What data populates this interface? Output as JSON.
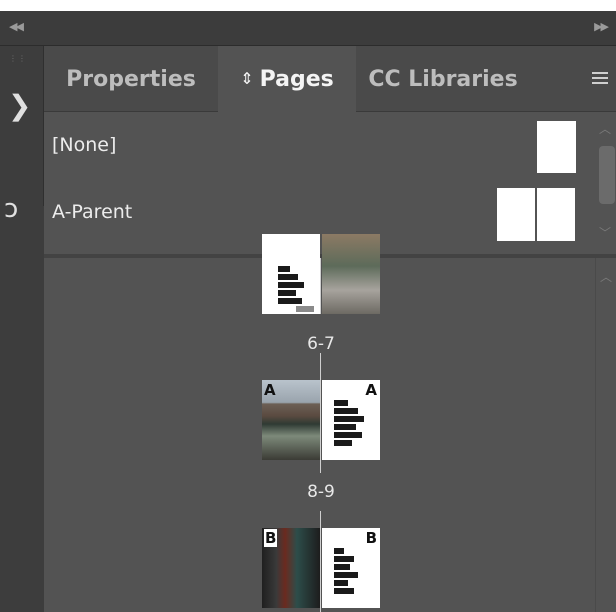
{
  "tabs": [
    {
      "label": "Properties",
      "active": false
    },
    {
      "label": "Pages",
      "active": true
    },
    {
      "label": "CC Libraries",
      "active": false
    }
  ],
  "active_tab_glyph": "⇕",
  "parents": [
    {
      "label": "[None]",
      "thumb": "single-page"
    },
    {
      "label": "A-Parent",
      "thumb": "spread"
    }
  ],
  "spreads": [
    {
      "label": "6-7",
      "left_prefix": "",
      "right_prefix": ""
    },
    {
      "label": "8-9",
      "left_prefix": "A",
      "right_prefix": "A"
    },
    {
      "label": "",
      "left_prefix": "B",
      "right_prefix": "B"
    }
  ],
  "icons": {
    "collapse_left": "double-chevron-left-icon",
    "collapse_right": "double-chevron-right-icon",
    "panel_menu": "hamburger-menu-icon",
    "grip": "panel-grip-icon"
  },
  "colors": {
    "panel_bg": "#535353",
    "tab_bar_bg": "#4a4a4a",
    "dock_bg": "#3d3d3d",
    "header_bar_bg": "#3c3c3c"
  }
}
